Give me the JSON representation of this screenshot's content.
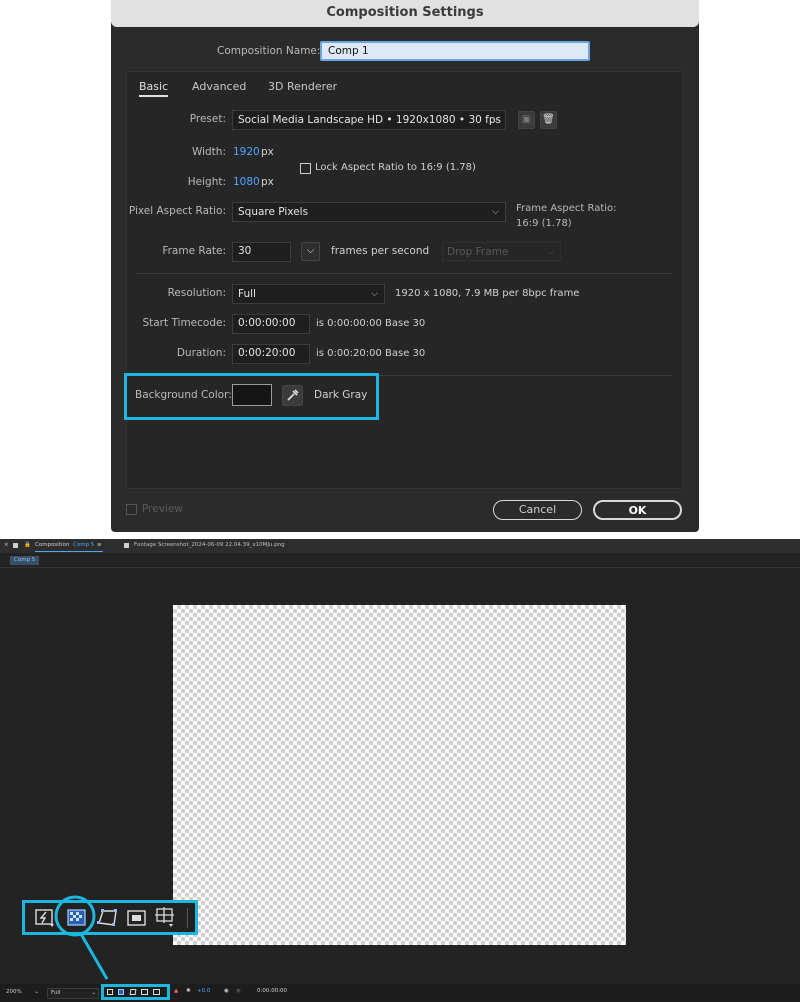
{
  "dialog": {
    "title": "Composition Settings",
    "comp_name_label": "Composition Name:",
    "comp_name_value": "Comp 1",
    "tabs": [
      "Basic",
      "Advanced",
      "3D Renderer"
    ],
    "preset_label": "Preset:",
    "preset_value": "Social Media Landscape HD  •  1920x1080 • 30 fps",
    "width_label": "Width:",
    "width_value": "1920",
    "height_label": "Height:",
    "height_value": "1080",
    "px_unit": "px",
    "lock_label": "Lock Aspect Ratio to 16:9 (1.78)",
    "par_label": "Pixel Aspect Ratio:",
    "par_value": "Square Pixels",
    "far_label": "Frame Aspect Ratio:",
    "far_value": "16:9 (1.78)",
    "frame_rate_label": "Frame Rate:",
    "frame_rate_value": "30",
    "fps_label": "frames per second",
    "drop_frame": "Drop Frame",
    "resolution_label": "Resolution:",
    "resolution_value": "Full",
    "resolution_info": "1920 x 1080, 7.9 MB per 8bpc frame",
    "start_tc_label": "Start Timecode:",
    "start_tc_value": "0:00:00:00",
    "start_tc_info": "is 0:00:00:00  Base 30",
    "duration_label": "Duration:",
    "duration_value": "0:00:20:00",
    "duration_info": "is 0:00:20:00  Base 30",
    "bg_color_label": "Background Color:",
    "bg_color_name": "Dark Gray",
    "bg_color_hex": "#151515",
    "preview_label": "Preview",
    "cancel_label": "Cancel",
    "ok_label": "OK"
  },
  "comp_panel": {
    "tab1_prefix": "Composition",
    "tab1_comp": "Comp 5",
    "tab2": "Footage Screenshot_2024-06-09 22.04.39_x10MJu.png",
    "chip": "Comp 5",
    "zoom": "200%",
    "resolution": "Full",
    "exposure": "+0.0",
    "timecode": "0:00:00:00"
  },
  "colors": {
    "highlight": "#1ab8de",
    "accent_blue": "#4ea6ff"
  }
}
